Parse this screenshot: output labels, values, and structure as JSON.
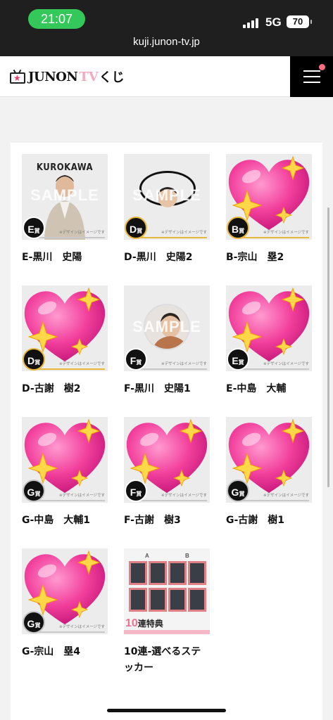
{
  "status_bar": {
    "time": "21:07",
    "network": "5G",
    "battery": "70"
  },
  "browser": {
    "url": "kuji.junon-tv.jp"
  },
  "header": {
    "logo_main": "JUNON",
    "logo_tv": "TV",
    "logo_kuji": "くじ",
    "menu_has_notification": true
  },
  "thumb_text": {
    "sample": "SAMPLE",
    "design_note": "※デザインはイメージです",
    "kurokawa": "KUROKAWA"
  },
  "items": [
    {
      "label": "E-黒川　史陽",
      "grade": "E",
      "suffix": "賞",
      "art": "photo-kurokawa",
      "covered": false
    },
    {
      "label": "D-黒川　史陽2",
      "grade": "D",
      "suffix": "賞",
      "art": "ring-face",
      "covered": false
    },
    {
      "label": "B-宗山　塁2",
      "grade": "B",
      "suffix": "賞",
      "art": "heart",
      "covered": true
    },
    {
      "label": "D-古謝　樹2",
      "grade": "D",
      "suffix": "賞",
      "art": "heart",
      "covered": true
    },
    {
      "label": "F-黒川　史陽1",
      "grade": "F",
      "suffix": "賞",
      "art": "round-badge",
      "covered": false
    },
    {
      "label": "E-中島　大輔",
      "grade": "E",
      "suffix": "賞",
      "art": "heart",
      "covered": true
    },
    {
      "label": "G-中島　大輔1",
      "grade": "G",
      "suffix": "賞",
      "art": "heart",
      "covered": true
    },
    {
      "label": "F-古謝　樹3",
      "grade": "F",
      "suffix": "賞",
      "art": "heart",
      "covered": true
    },
    {
      "label": "G-古謝　樹1",
      "grade": "G",
      "suffix": "賞",
      "art": "heart",
      "covered": true
    },
    {
      "label": "G-宗山　塁4",
      "grade": "G",
      "suffix": "賞",
      "art": "heart",
      "covered": true
    },
    {
      "label": "10連-選べるステッカー",
      "grade": "",
      "suffix": "",
      "art": "bonus",
      "covered": false
    }
  ],
  "bonus": {
    "letter_a": "A",
    "letter_b": "B",
    "count": "10",
    "text": "連特典"
  },
  "colors": {
    "heart": "#f23f9c",
    "sparkle": "#ffd84a",
    "accent_pink": "#ff6b81"
  }
}
